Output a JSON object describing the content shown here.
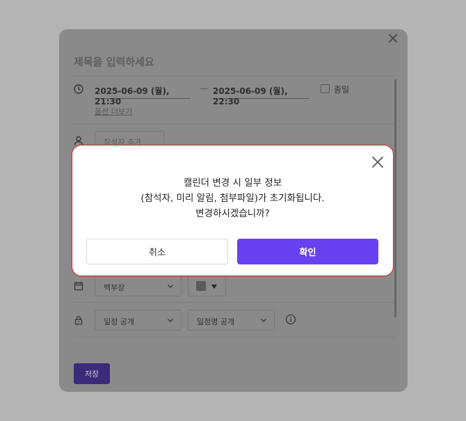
{
  "editor": {
    "title_placeholder": "제목을 입력하세요",
    "start_datetime": "2025-06-09 (월), 21:30",
    "end_datetime": "2025-06-09 (월), 22:30",
    "date_separator": "—",
    "all_day_label": "종일",
    "more_options_label": "옵션 더보기",
    "attendee_placeholder": "참석자 추가",
    "calendar_select": "백부장",
    "visibility_select": "일정 공개",
    "visibility_detail_select": "일정명 공개",
    "save_label": "저장",
    "close_icon": "close-icon"
  },
  "dialog": {
    "message_line1": "캘린더 변경 시 일부 정보",
    "message_line2": "(참석자, 미리 알림, 첨부파일)가 초기화됩니다.",
    "message_line3": "변경하시겠습니까?",
    "cancel_label": "취소",
    "confirm_label": "확인",
    "close_icon": "close-icon"
  },
  "colors": {
    "backdrop": "#b4b4b4",
    "dialog_border": "#d81e1e",
    "confirm_button": "#6842f0",
    "save_button": "#3a2a7a"
  }
}
